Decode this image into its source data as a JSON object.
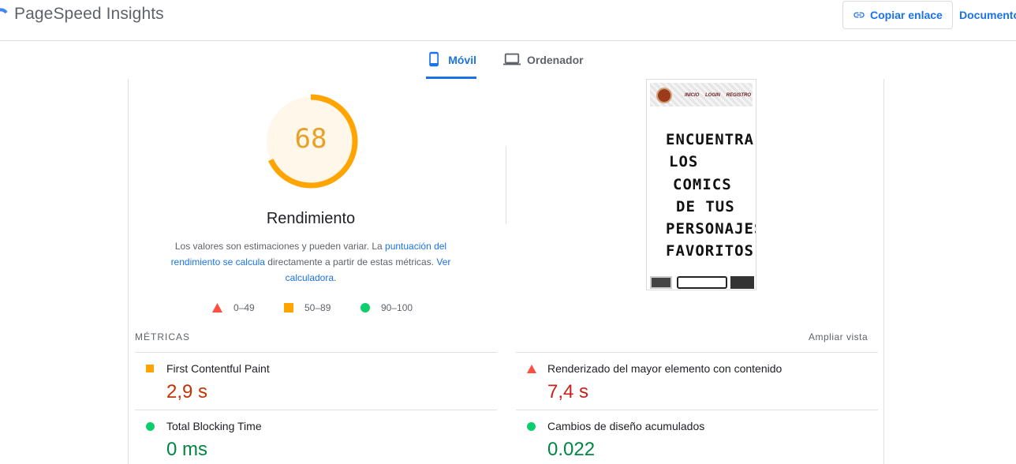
{
  "header": {
    "app_title": "PageSpeed Insights",
    "copy_button_label": "Copiar enlace",
    "docs_link_label": "Documento"
  },
  "tabs": [
    {
      "label": "Móvil",
      "icon": "smartphone-icon",
      "active": true
    },
    {
      "label": "Ordenador",
      "icon": "laptop-icon",
      "active": false
    }
  ],
  "performance": {
    "score": "68",
    "score_fraction": 0.68,
    "score_color": "#ffa400",
    "title": "Rendimiento",
    "description_prefix": "Los valores son estimaciones y pueden variar. La ",
    "description_link1": "puntuación del rendimiento se calcula",
    "description_middle": " directamente a partir de estas métricas. ",
    "description_link2": "Ver calculadora.",
    "legend": [
      {
        "shape": "triangle",
        "range": "0–49",
        "color": "#ff4e42"
      },
      {
        "shape": "square",
        "range": "50–89",
        "color": "#ffa400"
      },
      {
        "shape": "circle",
        "range": "90–100",
        "color": "#0cce6b"
      }
    ]
  },
  "screenshot": {
    "nav_text": "INICIO LOGIN REGISTRO",
    "headline_lines": [
      "ENCUENTRA",
      "LOS",
      "COMICS",
      "DE TUS",
      "PERSONAJES",
      "FAVORITOS"
    ]
  },
  "metrics": {
    "header": "MÉTRICAS",
    "expand_label": "Ampliar vista",
    "items": [
      {
        "label": "First Contentful Paint",
        "value": "2,9 s",
        "rating": "average",
        "color": "#ffa400"
      },
      {
        "label": "Renderizado del mayor elemento con contenido",
        "value": "7,4 s",
        "rating": "fail",
        "color": "#ff4e42"
      },
      {
        "label": "Total Blocking Time",
        "value": "0 ms",
        "rating": "pass",
        "color": "#0cce6b"
      },
      {
        "label": "Cambios de diseño acumulados",
        "value": "0.022",
        "rating": "pass",
        "color": "#0cce6b"
      }
    ]
  },
  "colors": {
    "accent": "#1a73e8",
    "pass": "#0cce6b",
    "average": "#ffa400",
    "fail": "#ff4e42"
  }
}
